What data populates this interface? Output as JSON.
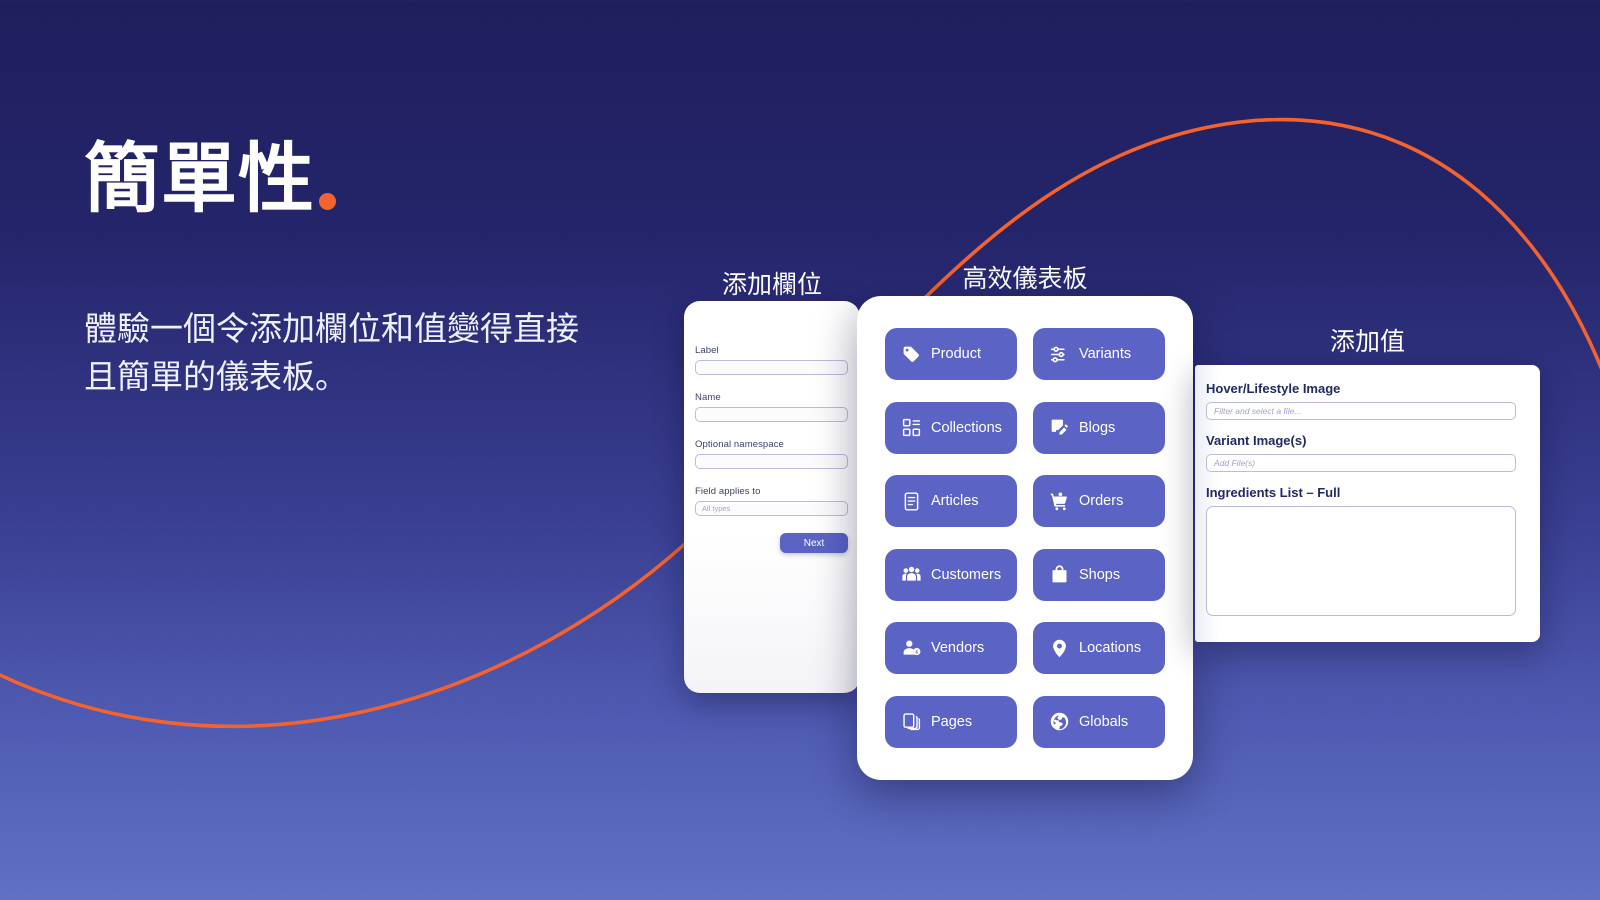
{
  "theme": {
    "bg_top": "#1f1f5e",
    "bg_bottom": "#6070c4",
    "accent_orange": "#f4632e",
    "tile_indigo": "#5b63c4",
    "card_white": "#ffffff"
  },
  "hero": {
    "headline": "簡單性",
    "headline_dot": "orange-dot",
    "subcopy": "體驗一個令添加欄位和值變得直接且簡單的儀表板。"
  },
  "form_card": {
    "title": "添加欄位",
    "fields": [
      {
        "label": "Label",
        "value": "",
        "placeholder": ""
      },
      {
        "label": "Name",
        "value": "",
        "placeholder": ""
      },
      {
        "label": "Optional namespace",
        "value": "",
        "placeholder": ""
      },
      {
        "label": "Field applies to",
        "value": "",
        "placeholder": "All types"
      }
    ],
    "next_label": "Next"
  },
  "dashboard_card": {
    "title": "高效儀表板",
    "tiles": [
      {
        "label": "Product",
        "icon": "tag-icon"
      },
      {
        "label": "Variants",
        "icon": "sliders-icon"
      },
      {
        "label": "Collections",
        "icon": "grid-icon"
      },
      {
        "label": "Blogs",
        "icon": "document-edit-icon"
      },
      {
        "label": "Articles",
        "icon": "document-icon"
      },
      {
        "label": "Orders",
        "icon": "shopping-cart-icon"
      },
      {
        "label": "Customers",
        "icon": "people-icon"
      },
      {
        "label": "Shops",
        "icon": "shopping-bag-icon"
      },
      {
        "label": "Vendors",
        "icon": "person-badge-icon"
      },
      {
        "label": "Locations",
        "icon": "map-pin-icon"
      },
      {
        "label": "Pages",
        "icon": "pages-icon"
      },
      {
        "label": "Globals",
        "icon": "globe-icon"
      }
    ]
  },
  "values_card": {
    "title": "添加值",
    "fields": [
      {
        "label": "Hover/Lifestyle Image",
        "placeholder": "Filter and select a file...",
        "type": "input"
      },
      {
        "label": "Variant Image(s)",
        "placeholder": "Add File(s)",
        "type": "input"
      },
      {
        "label": "Ingredients List – Full",
        "placeholder": "",
        "type": "textarea"
      }
    ]
  }
}
